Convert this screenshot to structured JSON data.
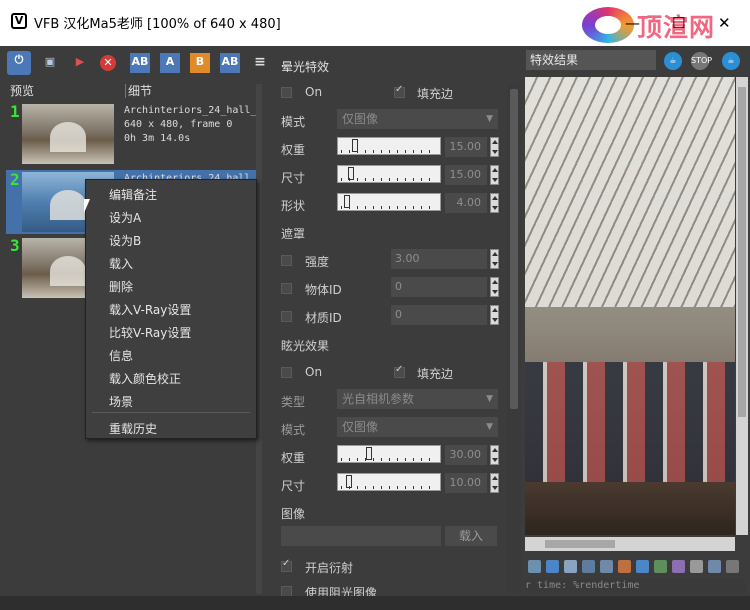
{
  "window": {
    "title": "VFB 汉化Ma5老师 [100% of 640 x 480]",
    "minimize": "—",
    "maximize": "☐",
    "close": "✕"
  },
  "watermark": {
    "text": "顶渲网"
  },
  "toolbar": {
    "a_label": "A",
    "b_label": "B",
    "ab_label": "AB"
  },
  "history": {
    "columns": [
      "预览",
      "细节"
    ],
    "items": [
      {
        "num": "1",
        "name": "Archinteriors_24_hall_",
        "res": "640 x 480, frame 0",
        "time": "0h 3m 14.0s"
      },
      {
        "num": "2",
        "name": "Archinteriors_24_hall",
        "res": "",
        "time": ""
      },
      {
        "num": "3",
        "name": "",
        "res": "",
        "time": ""
      }
    ]
  },
  "context_menu": {
    "items": [
      "编辑备注",
      "设为A",
      "设为B",
      "载入",
      "删除",
      "载入V-Ray设置",
      "比较V-Ray设置",
      "信息",
      "载入颜色校正",
      "场景"
    ],
    "after_sep": "重载历史"
  },
  "bloom": {
    "title": "晕光特效",
    "on_label": "On",
    "fill_label": "填充边",
    "mode_label": "模式",
    "mode_value": "仅图像",
    "weight_label": "权重",
    "weight_value": "15.00",
    "size_label": "尺寸",
    "size_value": "15.00",
    "shape_label": "形状",
    "shape_value": "4.00"
  },
  "mask": {
    "title": "遮罩",
    "intensity_label": "强度",
    "intensity_value": "3.00",
    "objid_label": "物体ID",
    "objid_value": "0",
    "mtlid_label": "材质ID",
    "mtlid_value": "0"
  },
  "glare": {
    "title": "眩光效果",
    "on_label": "On",
    "fill_label": "填充边",
    "type_label": "类型",
    "type_value": "光自相机参数",
    "mode_label": "模式",
    "mode_value": "仅图像",
    "weight_label": "权重",
    "weight_value": "30.00",
    "size_label": "尺寸",
    "size_value": "10.00",
    "image_label": "图像",
    "load_label": "载入",
    "diffraction_label": "开启衍射",
    "obstacle_label": "使用阻光图像"
  },
  "result": {
    "title": "特效结果",
    "stop_label": "STOP"
  },
  "status": {
    "text": "r time: %rendertime"
  }
}
